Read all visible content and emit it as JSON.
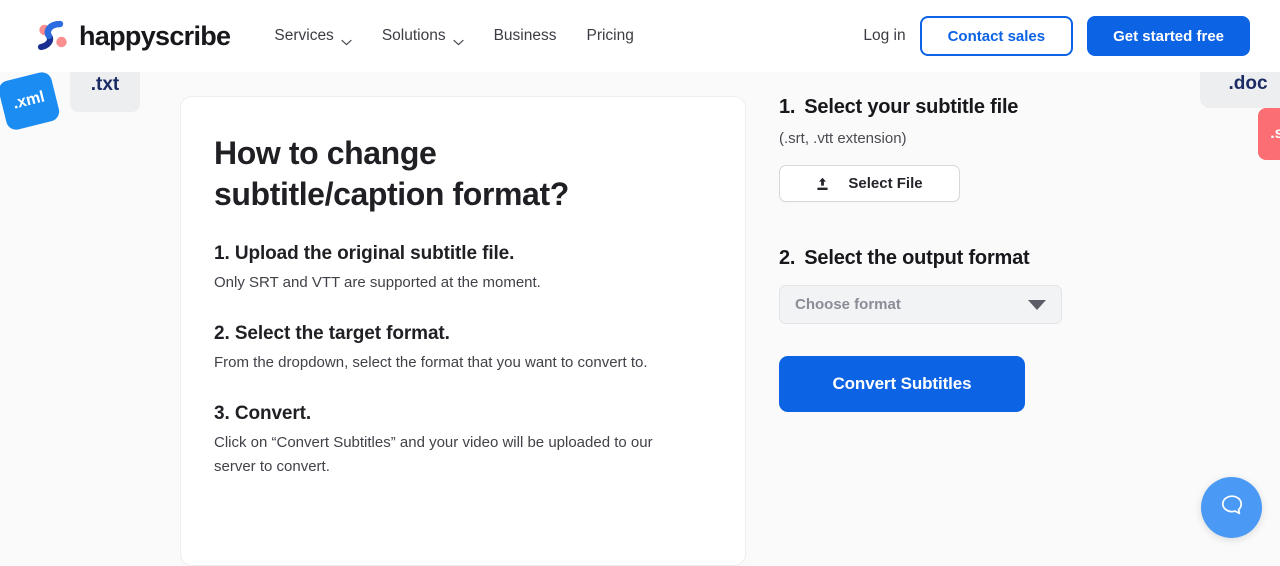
{
  "header": {
    "brand": "happyscribe",
    "logo_icon": "happyscribe-s-logo",
    "nav": [
      {
        "label": "Services",
        "has_chevron": true,
        "icon": "chevron-down-icon"
      },
      {
        "label": "Solutions",
        "has_chevron": true,
        "icon": "chevron-down-icon"
      },
      {
        "label": "Business",
        "has_chevron": false
      },
      {
        "label": "Pricing",
        "has_chevron": false
      }
    ],
    "login_label": "Log in",
    "contact_sales_label": "Contact sales",
    "get_started_label": "Get started free"
  },
  "decor": {
    "xml_tile": ".xml",
    "txt_tile": ".txt",
    "grey_right_tile": ".doc",
    "pink_right_tile": ".sr"
  },
  "card": {
    "title": "How to change\nsubtitle/caption format?",
    "steps": [
      {
        "head": "1. Upload the original subtitle file.",
        "body": "Only SRT and VTT are supported at the moment."
      },
      {
        "head": "2. Select the target format.",
        "body": "From the dropdown, select the format that you want to convert to."
      },
      {
        "head": "3. Convert.",
        "body": "Click on “Convert Subtitles” and your video will be uploaded to our server to convert."
      }
    ]
  },
  "panel": {
    "step1": {
      "number": "1.",
      "title": "Select your subtitle file",
      "subtitle": "(.srt, .vtt extension)",
      "file_button_label": "Select File",
      "file_button_icon": "upload-icon"
    },
    "step2": {
      "number": "2.",
      "title": "Select the output format",
      "select_placeholder": "Choose format",
      "select_icon": "caret-down-icon"
    },
    "convert_label": "Convert Subtitles"
  },
  "chat": {
    "icon": "chat-bubble-icon"
  },
  "colors": {
    "accent_blue": "#0c63e4",
    "logo_navy": "#1a2f8f",
    "logo_pink": "#fb8e8e",
    "tile_blue": "#1b8cf2",
    "tile_pink": "#fb6e74",
    "page_bg": "#fafafa",
    "chat_blue": "#4a9af5"
  }
}
